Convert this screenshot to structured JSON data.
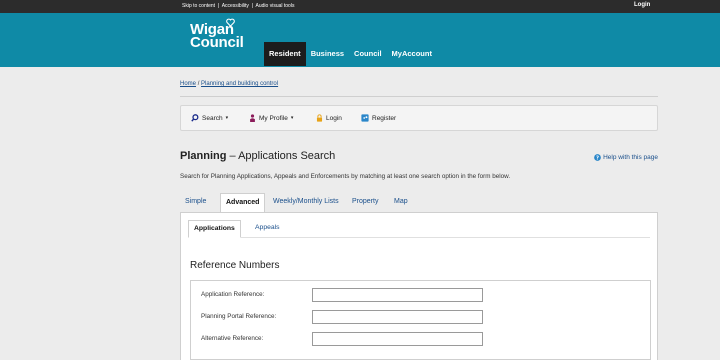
{
  "topbar": {
    "skip_to_content": "Skip to content",
    "accessibility": "Accessibility",
    "audio_visual": "Audio visual tools",
    "separator": "|",
    "login": "Login"
  },
  "logo": {
    "line1": "Wigan",
    "line2": "Council"
  },
  "main_nav": {
    "items": [
      {
        "label": "Resident",
        "active": true
      },
      {
        "label": "Business",
        "active": false
      },
      {
        "label": "Council",
        "active": false
      },
      {
        "label": "MyAccount",
        "active": false
      }
    ]
  },
  "breadcrumb": {
    "home": "Home",
    "separator": "/",
    "current": "Planning and building control"
  },
  "toolbar": {
    "search": "Search",
    "my_profile": "My Profile",
    "login": "Login",
    "register": "Register"
  },
  "page": {
    "title_bold": "Planning",
    "title_rest": "– Applications Search",
    "help": "Help with this page",
    "description": "Search for Planning Applications, Appeals and Enforcements by matching at least one search option in the form below."
  },
  "tabs": [
    {
      "label": "Simple",
      "active": false
    },
    {
      "label": "Advanced",
      "active": true
    },
    {
      "label": "Weekly/Monthly Lists",
      "active": false
    },
    {
      "label": "Property",
      "active": false
    },
    {
      "label": "Map",
      "active": false
    }
  ],
  "subtabs": [
    {
      "label": "Applications",
      "active": true
    },
    {
      "label": "Appeals",
      "active": false
    }
  ],
  "reference_section": {
    "title": "Reference Numbers",
    "fields": [
      {
        "label": "Application Reference:",
        "value": ""
      },
      {
        "label": "Planning Portal Reference:",
        "value": ""
      },
      {
        "label": "Alternative Reference:",
        "value": ""
      }
    ]
  },
  "colors": {
    "header_teal": "#0f8aa6",
    "topbar_dark": "#2c2c2c",
    "link_blue": "#1a4f8b",
    "nav_active": "#1c1c1c"
  }
}
